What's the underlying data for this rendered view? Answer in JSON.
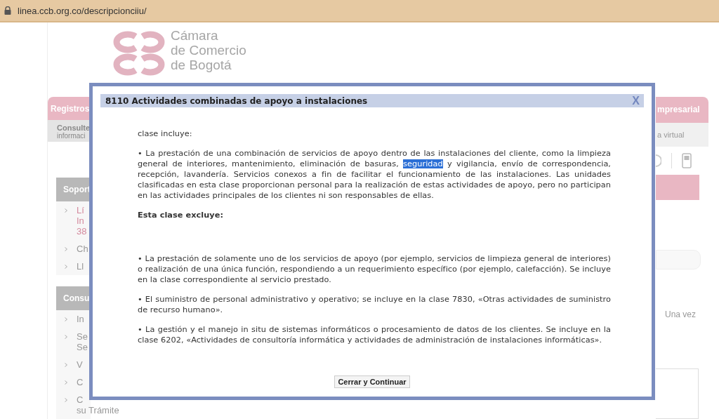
{
  "browser": {
    "url": "linea.ccb.org.co/descripcionciiu/"
  },
  "logo": {
    "lines": [
      "Cámara",
      "de Comercio",
      "de Bogotá"
    ]
  },
  "background_left": {
    "tab": "Registros",
    "sub_title": "Consulte",
    "sub_text": "informaci",
    "sections": [
      {
        "header": "Soport",
        "items": [
          {
            "lines": [
              "Lí",
              "In",
              "38"
            ],
            "kind": "link"
          },
          {
            "lines": [
              "Ch"
            ],
            "kind": "plain"
          },
          {
            "lines": [
              "Ll"
            ],
            "kind": "plain"
          }
        ]
      },
      {
        "header": "Consu",
        "items": [
          {
            "lines": [
              "In"
            ],
            "kind": "plain"
          },
          {
            "lines": [
              "Se",
              "Se"
            ],
            "kind": "plain"
          },
          {
            "lines": [
              "V"
            ],
            "kind": "plain"
          },
          {
            "lines": [
              "C"
            ],
            "kind": "plain"
          },
          {
            "lines": [
              "C",
              "su Trámite"
            ],
            "kind": "plain"
          }
        ]
      }
    ]
  },
  "background_right": {
    "tab": "mpresarial",
    "sub_text": "a virtual",
    "text": "Una vez"
  },
  "dialog": {
    "title": "8110 Actividades combinadas de apoyo a instalaciones",
    "close": "X",
    "paragraphs": [
      {
        "kind": "text",
        "segments": [
          {
            "text": "clase incluye:",
            "highlighted": false
          }
        ]
      },
      {
        "kind": "text",
        "segments": [
          {
            "text": "• La prestación de una combinación de servicios de apoyo dentro de las instalaciones del cliente, como la limpieza general de interiores, mantenimiento, eliminación de basuras, ",
            "highlighted": false
          },
          {
            "text": "seguridad",
            "highlighted": true
          },
          {
            "text": " y vigilancia, envío de correspondencia, recepción, lavandería. Servicios conexos a fin de facilitar el funcionamiento de las instalaciones. Las unidades clasificadas en esta clase proporcionan personal para la realización de estas actividades de apoyo, pero no participan en las actividades principales de los clientes ni son responsables de ellas.",
            "highlighted": false
          }
        ]
      },
      {
        "kind": "heading",
        "segments": [
          {
            "text": "Esta clase excluye:",
            "highlighted": false
          }
        ]
      },
      {
        "kind": "text",
        "segments": [
          {
            "text": "• La prestación de solamente uno de los servicios de apoyo (por ejemplo, servicios de limpieza general de interiores) o realización de una única función, respondiendo a un requerimiento específico (por ejemplo, calefacción). Se incluye en la clase correspondiente al servicio prestado.",
            "highlighted": false
          }
        ]
      },
      {
        "kind": "text",
        "segments": [
          {
            "text": "• El suministro de personal administrativo y operativo; se incluye en la clase 7830, «Otras actividades de suministro de recurso humano».",
            "highlighted": false
          }
        ]
      },
      {
        "kind": "text",
        "segments": [
          {
            "text": "• La gestión y el manejo in situ de sistemas informáticos o procesamiento de datos de los clientes. Se incluye en la clase 6202, «Actividades de consultoría informática y actividades de administración de instalaciones informáticas».",
            "highlighted": false
          }
        ]
      }
    ],
    "button": "Cerrar y Continuar"
  }
}
